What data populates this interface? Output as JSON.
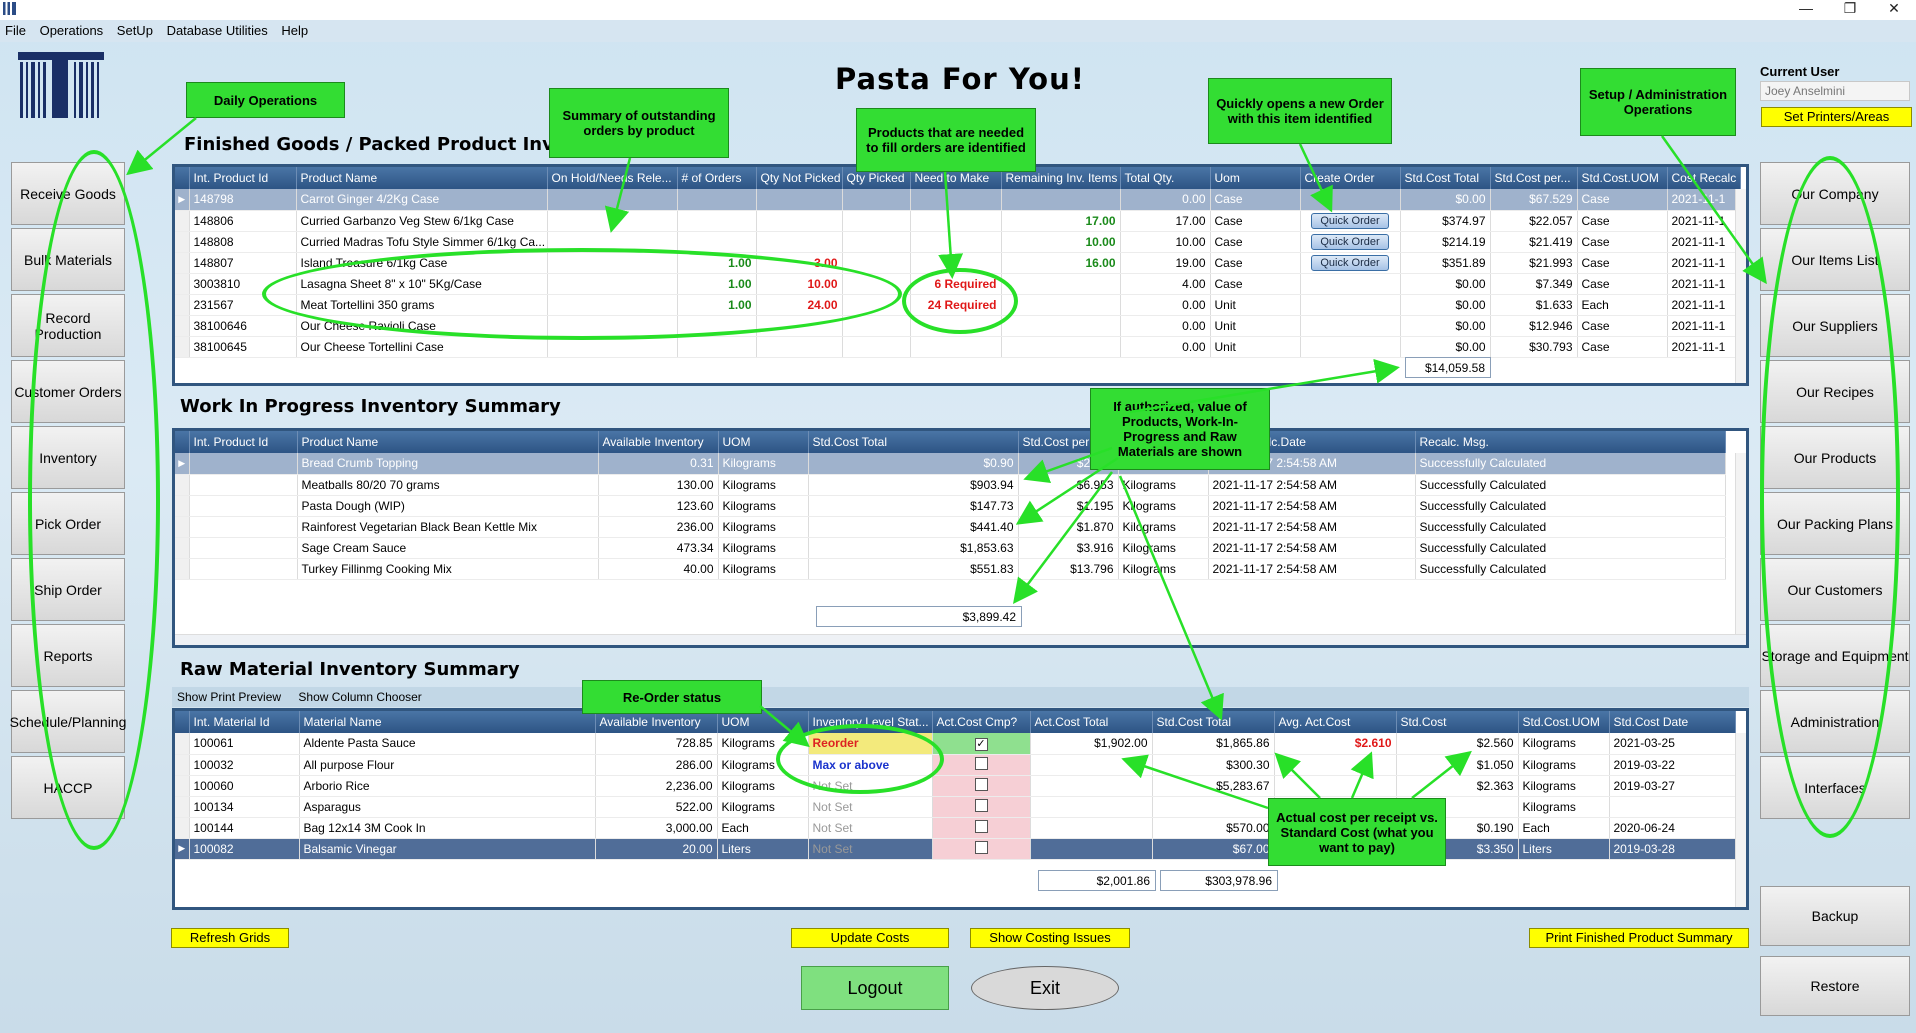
{
  "menu": [
    "File",
    "Operations",
    "SetUp",
    "Database Utilities",
    "Help"
  ],
  "window_controls": [
    "—",
    "❐",
    "✕"
  ],
  "app_title": "Pasta For You!",
  "current_user": {
    "label": "Current User",
    "name": "Joey  Anselmini"
  },
  "set_printers": "Set Printers/Areas",
  "left_nav": [
    "Receive Goods",
    "Bulk Materials",
    "Record Production",
    "Customer Orders",
    "Inventory",
    "Pick Order",
    "Ship Order",
    "Reports",
    "Schedule/Planning",
    "HACCP"
  ],
  "right_nav": [
    "Our Company",
    "Our Items List",
    "Our Suppliers",
    "Our Recipes",
    "Our Products",
    "Our Packing Plans",
    "Our Customers",
    "Storage and Equipment",
    "Administration",
    "Interfaces"
  ],
  "right_bottom": [
    "Backup",
    "Restore"
  ],
  "finished": {
    "title": "Finished Goods / Packed Product Inventory",
    "headers": [
      "Int. Product Id",
      "Product Name",
      "On Hold/Needs Rele...",
      "# of Orders",
      "Qty Not Picked",
      "Qty Picked",
      "Need to Make",
      "Remaining Inv. Items",
      "Total Qty.",
      "Uom",
      "Create Order",
      "Std.Cost Total",
      "Std.Cost per...",
      "Std.Cost.UOM",
      "Cost Recalc"
    ],
    "rows": [
      [
        "148798",
        "Carrot Ginger 4/2Kg Case",
        "",
        "",
        "",
        "",
        "",
        "",
        "0.00",
        "Case",
        "",
        "$0.00",
        "$67.529",
        "Case",
        "2021-11-1"
      ],
      [
        "148806",
        "Curried Garbanzo Veg Stew 6/1kg Case",
        "",
        "",
        "",
        "",
        "",
        "17.00",
        "17.00",
        "Case",
        "Quick Order",
        "$374.97",
        "$22.057",
        "Case",
        "2021-11-1"
      ],
      [
        "148808",
        "Curried Madras Tofu Style Simmer 6/1kg Ca...",
        "",
        "",
        "",
        "",
        "",
        "10.00",
        "10.00",
        "Case",
        "Quick Order",
        "$214.19",
        "$21.419",
        "Case",
        "2021-11-1"
      ],
      [
        "148807",
        "Island Treasure 6/1kg Case",
        "",
        "1.00",
        "3.00",
        "",
        "",
        "16.00",
        "19.00",
        "Case",
        "Quick Order",
        "$351.89",
        "$21.993",
        "Case",
        "2021-11-1"
      ],
      [
        "3003810",
        "Lasagna Sheet 8\" x 10\" 5Kg/Case",
        "",
        "1.00",
        "10.00",
        "",
        "6 Required",
        "",
        "4.00",
        "Case",
        "",
        "$0.00",
        "$7.349",
        "Case",
        "2021-11-1"
      ],
      [
        "231567",
        "Meat Tortellini 350 grams",
        "",
        "1.00",
        "24.00",
        "",
        "24 Required",
        "",
        "0.00",
        "Unit",
        "",
        "$0.00",
        "$1.633",
        "Each",
        "2021-11-1"
      ],
      [
        "38100646",
        "Our Cheese Ravioli Case",
        "",
        "",
        "",
        "",
        "",
        "",
        "0.00",
        "Unit",
        "",
        "$0.00",
        "$12.946",
        "Case",
        "2021-11-1"
      ],
      [
        "38100645",
        "Our Cheese Tortellini Case",
        "",
        "",
        "",
        "",
        "",
        "",
        "0.00",
        "Unit",
        "",
        "$0.00",
        "$30.793",
        "Case",
        "2021-11-1"
      ]
    ],
    "total": "$14,059.58"
  },
  "wip": {
    "title": "Work In Progress Inventory Summary",
    "headers": [
      "Int. Product Id",
      "Product Name",
      "Available Inventory",
      "UOM",
      "Std.Cost Total",
      "Std.Cost per",
      "Std.Cost.UOM",
      "Cost Recalc.Date",
      "Recalc. Msg."
    ],
    "rows": [
      [
        "",
        "Bread Crumb Topping",
        "0.31",
        "Kilograms",
        "$0.90",
        "$2.903",
        "Kilograms",
        "2021-11-17 2:54:58 AM",
        "Successfully Calculated"
      ],
      [
        "",
        "Meatballs 80/20 70 grams",
        "130.00",
        "Kilograms",
        "$903.94",
        "$6.953",
        "Kilograms",
        "2021-11-17 2:54:58 AM",
        "Successfully Calculated"
      ],
      [
        "",
        "Pasta Dough (WIP)",
        "123.60",
        "Kilograms",
        "$147.73",
        "$1.195",
        "Kilograms",
        "2021-11-17 2:54:58 AM",
        "Successfully Calculated"
      ],
      [
        "",
        "Rainforest Vegetarian Black Bean Kettle Mix",
        "236.00",
        "Kilograms",
        "$441.40",
        "$1.870",
        "Kilograms",
        "2021-11-17 2:54:58 AM",
        "Successfully Calculated"
      ],
      [
        "",
        "Sage Cream Sauce",
        "473.34",
        "Kilograms",
        "$1,853.63",
        "$3.916",
        "Kilograms",
        "2021-11-17 2:54:58 AM",
        "Successfully Calculated"
      ],
      [
        "",
        "Turkey Fillinmg Cooking Mix",
        "40.00",
        "Kilograms",
        "$551.83",
        "$13.796",
        "Kilograms",
        "2021-11-17 2:54:58 AM",
        "Successfully Calculated"
      ]
    ],
    "total": "$3,899.42"
  },
  "raw": {
    "title": "Raw Material Inventory Summary",
    "toolbar": [
      "Show Print Preview",
      "Show Column Chooser"
    ],
    "headers": [
      "Int. Material Id",
      "Material Name",
      "Available Inventory",
      "UOM",
      "Inventory Level Stat...",
      "Act.Cost Cmp?",
      "Act.Cost Total",
      "Std.Cost Total",
      "Avg. Act.Cost",
      "Std.Cost",
      "Std.Cost.UOM",
      "Std.Cost Date"
    ],
    "rows": [
      [
        "100061",
        "Aldente Pasta Sauce",
        "728.85",
        "Kilograms",
        "Reorder",
        "✓",
        "$1,902.00",
        "$1,865.86",
        "$2.610",
        "$2.560",
        "Kilograms",
        "2021-03-25"
      ],
      [
        "100032",
        "All purpose Flour",
        "286.00",
        "Kilograms",
        "Max or above",
        "",
        "",
        "$300.30",
        "",
        "$1.050",
        "Kilograms",
        "2019-03-22"
      ],
      [
        "100060",
        "Arborio Rice",
        "2,236.00",
        "Kilograms",
        "Not Set",
        "",
        "",
        "$5,283.67",
        "",
        "$2.363",
        "Kilograms",
        "2019-03-27"
      ],
      [
        "100134",
        "Asparagus",
        "522.00",
        "Kilograms",
        "Not Set",
        "",
        "",
        "",
        "",
        "",
        "Kilograms",
        ""
      ],
      [
        "100144",
        "Bag 12x14 3M Cook In",
        "3,000.00",
        "Each",
        "Not Set",
        "",
        "",
        "$570.00",
        "",
        "$0.190",
        "Each",
        "2020-06-24"
      ],
      [
        "100082",
        "Balsamic Vinegar",
        "20.00",
        "Liters",
        "Not Set",
        "",
        "",
        "$67.00",
        "",
        "$3.350",
        "Liters",
        "2019-03-28"
      ]
    ],
    "total_act": "$2,001.86",
    "total_std": "$303,978.96"
  },
  "buttons": {
    "refresh": "Refresh Grids",
    "update_costs": "Update Costs",
    "costing_issues": "Show Costing Issues",
    "print_summary": "Print Finished Product Summary",
    "logout": "Logout",
    "exit": "Exit"
  },
  "callouts": {
    "daily": "Daily Operations",
    "summary": "Summary of outstanding orders by product",
    "products_needed": "Products that are needed to fill orders are identified",
    "quick": "Quickly opens a new Order with this item identified",
    "setup": "Setup / Administration Operations",
    "authorized": "If authorized, value of Products, Work-In-Progress and Raw Materials are shown",
    "reorder": "Re-Order status",
    "actual": "Actual cost per receipt vs. Standard Cost (what you want to pay)"
  }
}
